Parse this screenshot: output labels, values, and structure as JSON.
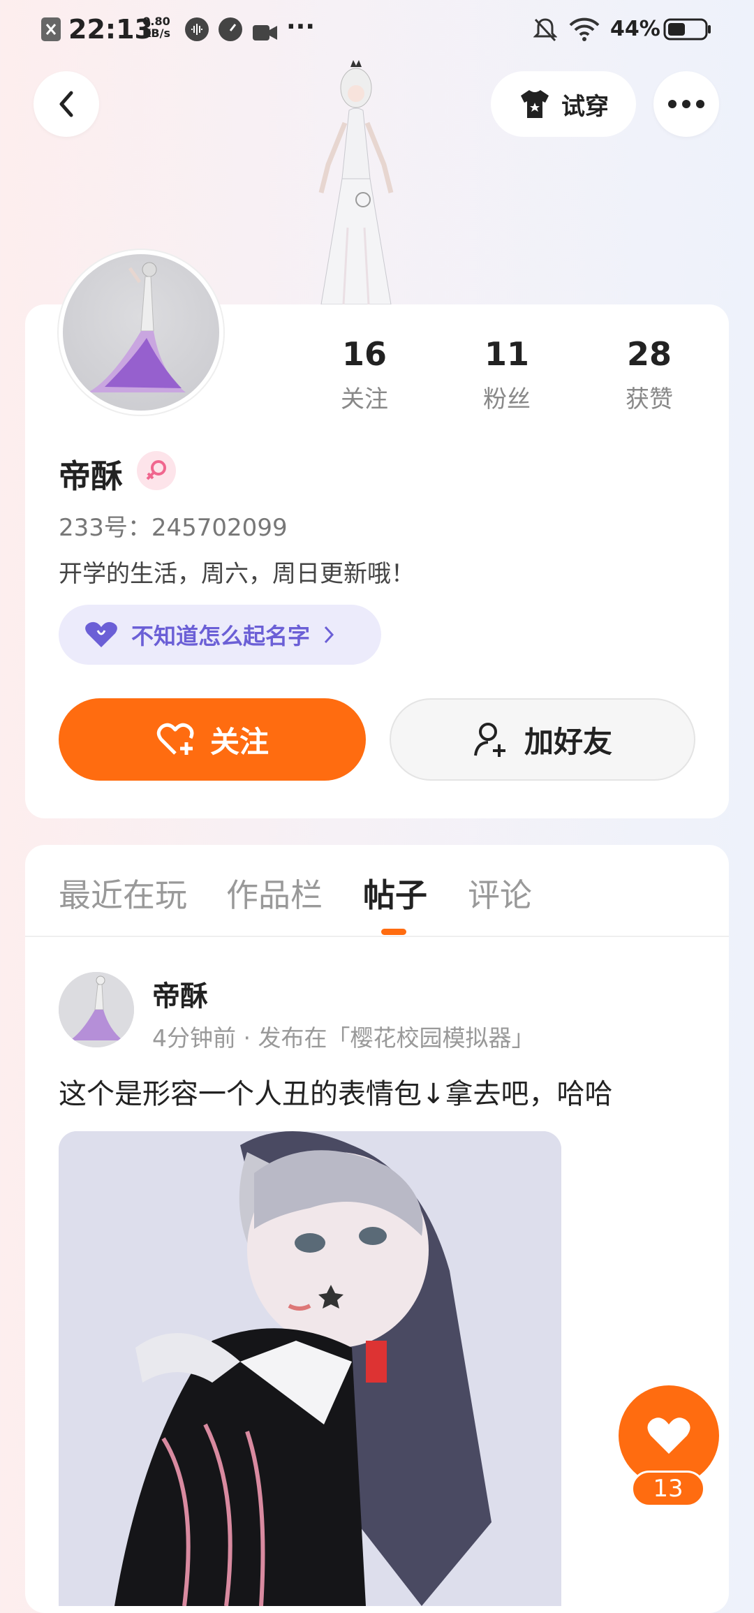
{
  "status_bar": {
    "time": "22:13",
    "speed_value": "0.80",
    "speed_unit": "KB/s",
    "battery": "44%"
  },
  "header": {
    "try_on_label": "试穿"
  },
  "profile": {
    "stats": [
      {
        "value": "16",
        "label": "关注"
      },
      {
        "value": "11",
        "label": "粉丝"
      },
      {
        "value": "28",
        "label": "获赞"
      }
    ],
    "name": "帝酥",
    "uid": "233号：245702099",
    "bio": "开学的生活，周六，周日更新哦！",
    "tag": "不知道怎么起名字",
    "follow_label": "关注",
    "add_friend_label": "加好友"
  },
  "tabs": [
    "最近在玩",
    "作品栏",
    "帖子",
    "评论"
  ],
  "active_tab": "帖子",
  "post": {
    "author": "帝酥",
    "meta": "4分钟前 · 发布在「樱花校园模拟器」",
    "text": "这个是形容一个人丑的表情包↓拿去吧，哈哈",
    "like_count": "13"
  },
  "colors": {
    "accent": "#ff6c10",
    "tag_text": "#6b5fd6",
    "tag_bg": "#ecebfb"
  }
}
